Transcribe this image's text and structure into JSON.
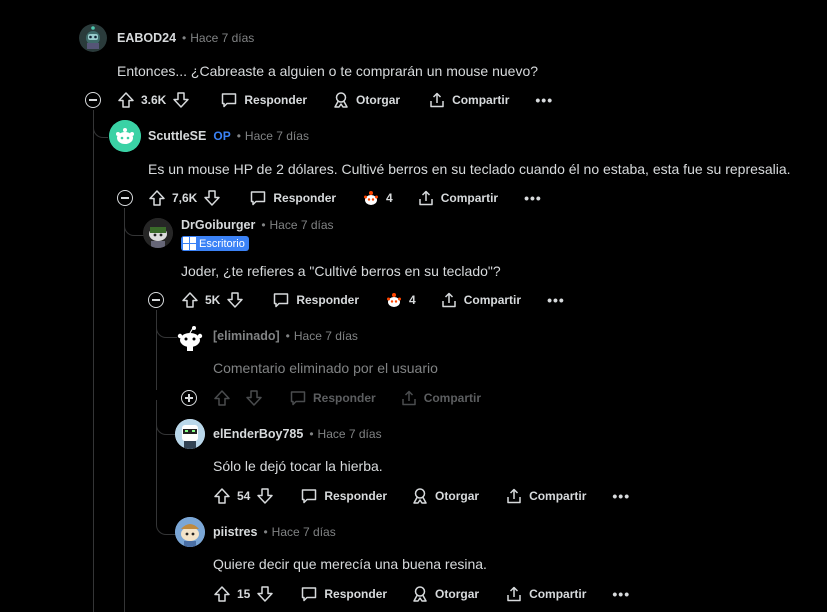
{
  "labels": {
    "reply": "Responder",
    "award": "Otorgar",
    "share": "Compartir",
    "more": "•••",
    "dot": "•"
  },
  "comments": [
    {
      "username": "EABOD24",
      "time": "Hace 7 días",
      "body": "Entonces... ¿Cabreaste a alguien o te comprarán un mouse nuevo?",
      "votes": "3.6K"
    },
    {
      "username": "ScuttleSE",
      "op_badge": "OP",
      "time": "Hace 7 días",
      "body": "Es un mouse HP de 2 dólares. Cultivé berros en su teclado cuando él no estaba, esta fue su represalia.",
      "votes": "7,6K",
      "award_count": "4"
    },
    {
      "username": "DrGoiburger",
      "flair": "Escritorio",
      "time": "Hace 7 días",
      "body": "Joder, ¿te refieres a \"Cultivé berros en su teclado\"?",
      "votes": "5K",
      "award_count": "4"
    },
    {
      "username": "[eliminado]",
      "time": "Hace 7 días",
      "body": "Comentario eliminado por el usuario"
    },
    {
      "username": "elEnderBoy785",
      "time": "Hace 7 días",
      "body": "Sólo le dejó tocar la hierba.",
      "votes": "54"
    },
    {
      "username": "piistres",
      "time": "Hace 7 días",
      "body": "Quiere decir que merecía una buena resina.",
      "votes": "15"
    }
  ],
  "colors": {
    "background": "#000000",
    "text": "#d7dadc",
    "muted": "#818384",
    "op_blue": "#3b82f6",
    "thread_line": "#343536"
  }
}
